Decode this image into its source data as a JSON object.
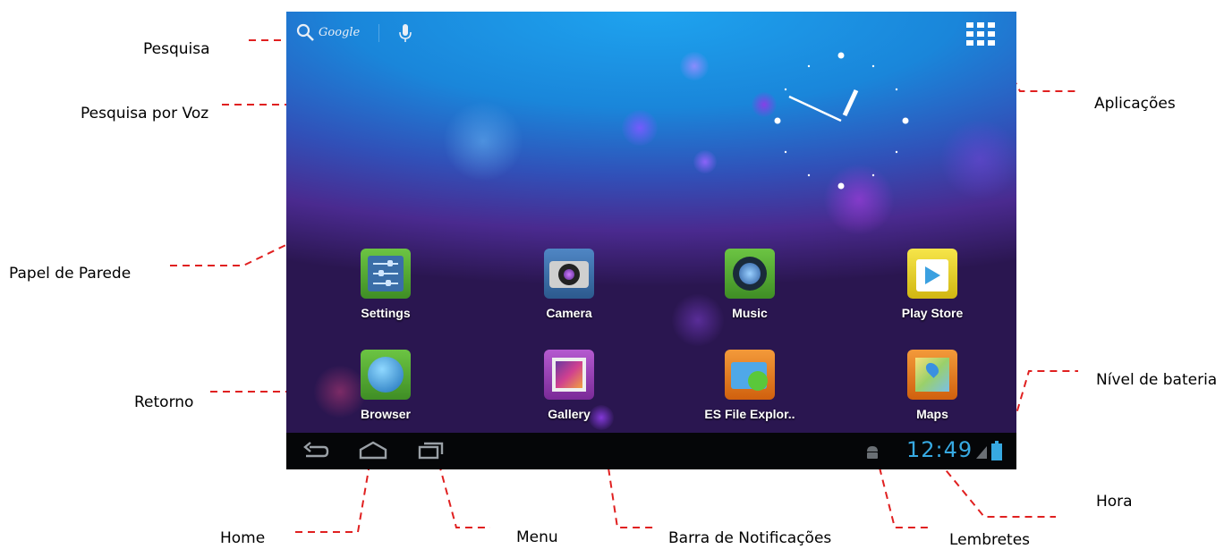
{
  "annotations": {
    "search": "Pesquisa",
    "voice_search": "Pesquisa por Voz",
    "wallpaper": "Papel de Parede",
    "apps": "Aplicações",
    "back": "Retorno",
    "home": "Home",
    "menu": "Menu",
    "notification_bar": "Barra de Notificações",
    "reminders": "Lembretes",
    "time": "Hora",
    "battery": "Nível de bateria"
  },
  "screen": {
    "search_widget": {
      "label": "Google",
      "icon": "search-icon"
    },
    "voice_icon": "microphone-icon",
    "apps_icon": "apps-grid-icon",
    "apps": [
      {
        "name": "Settings",
        "icon": "settings-icon",
        "color": "#4aa02c"
      },
      {
        "name": "Camera",
        "icon": "camera-icon",
        "color": "#3a6ea8"
      },
      {
        "name": "Music",
        "icon": "music-icon",
        "color": "#4aa02c"
      },
      {
        "name": "Play Store",
        "icon": "play-store-icon",
        "color": "#e8d51e"
      },
      {
        "name": "Browser",
        "icon": "browser-icon",
        "color": "#4aa02c"
      },
      {
        "name": "Gallery",
        "icon": "gallery-icon",
        "color": "#9b3fb5"
      },
      {
        "name": "ES File Explor..",
        "icon": "folder-icon",
        "color": "#e87a18"
      },
      {
        "name": "Maps",
        "icon": "maps-icon",
        "color": "#e8721e"
      }
    ],
    "navbar": {
      "back_icon": "back-icon",
      "home_icon": "home-icon",
      "recent_icon": "recent-apps-icon",
      "notification_icon": "android-icon",
      "time": "12:49",
      "signal_icon": "signal-icon",
      "battery_icon": "battery-icon"
    }
  },
  "colors": {
    "annotation_line": "#e02020",
    "time_text": "#37a9e2",
    "navbar_bg": "#050608"
  }
}
